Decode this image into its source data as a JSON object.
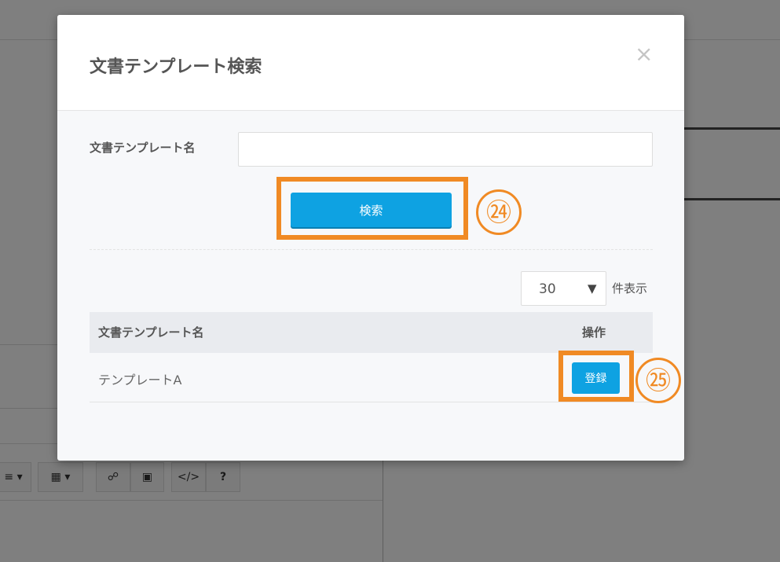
{
  "background": {
    "toolbar": {
      "items": [
        {
          "label": "≡ ▾",
          "icon": "list-dropdown-icon"
        },
        {
          "label": "▦ ▾",
          "icon": "table-icon"
        },
        {
          "label": "☍",
          "icon": "link-icon"
        },
        {
          "label": "▣",
          "icon": "image-icon"
        },
        {
          "label": "</>",
          "icon": "code-view-icon"
        },
        {
          "label": "?",
          "icon": "help-icon"
        }
      ]
    }
  },
  "modal": {
    "title": "文書テンプレート検索",
    "close_label": "×",
    "search_form": {
      "field_label": "文書テンプレート名",
      "input_value": "",
      "input_placeholder": "",
      "search_button_label": "検索"
    },
    "annotations": {
      "search_marker": "㉔",
      "register_marker": "㉕",
      "highlight_color": "#f08a24"
    },
    "results": {
      "page_size": "30",
      "page_size_arrow": "▼",
      "page_size_suffix": "件表示",
      "columns": [
        "文書テンプレート名",
        "操作"
      ],
      "rows": [
        {
          "name": "テンプレートA",
          "action_label": "登録"
        }
      ]
    }
  },
  "colors": {
    "primary_button": "#0ea2e2",
    "annotation": "#f08a24",
    "overlay": "rgba(0,0,0,0.5)"
  }
}
